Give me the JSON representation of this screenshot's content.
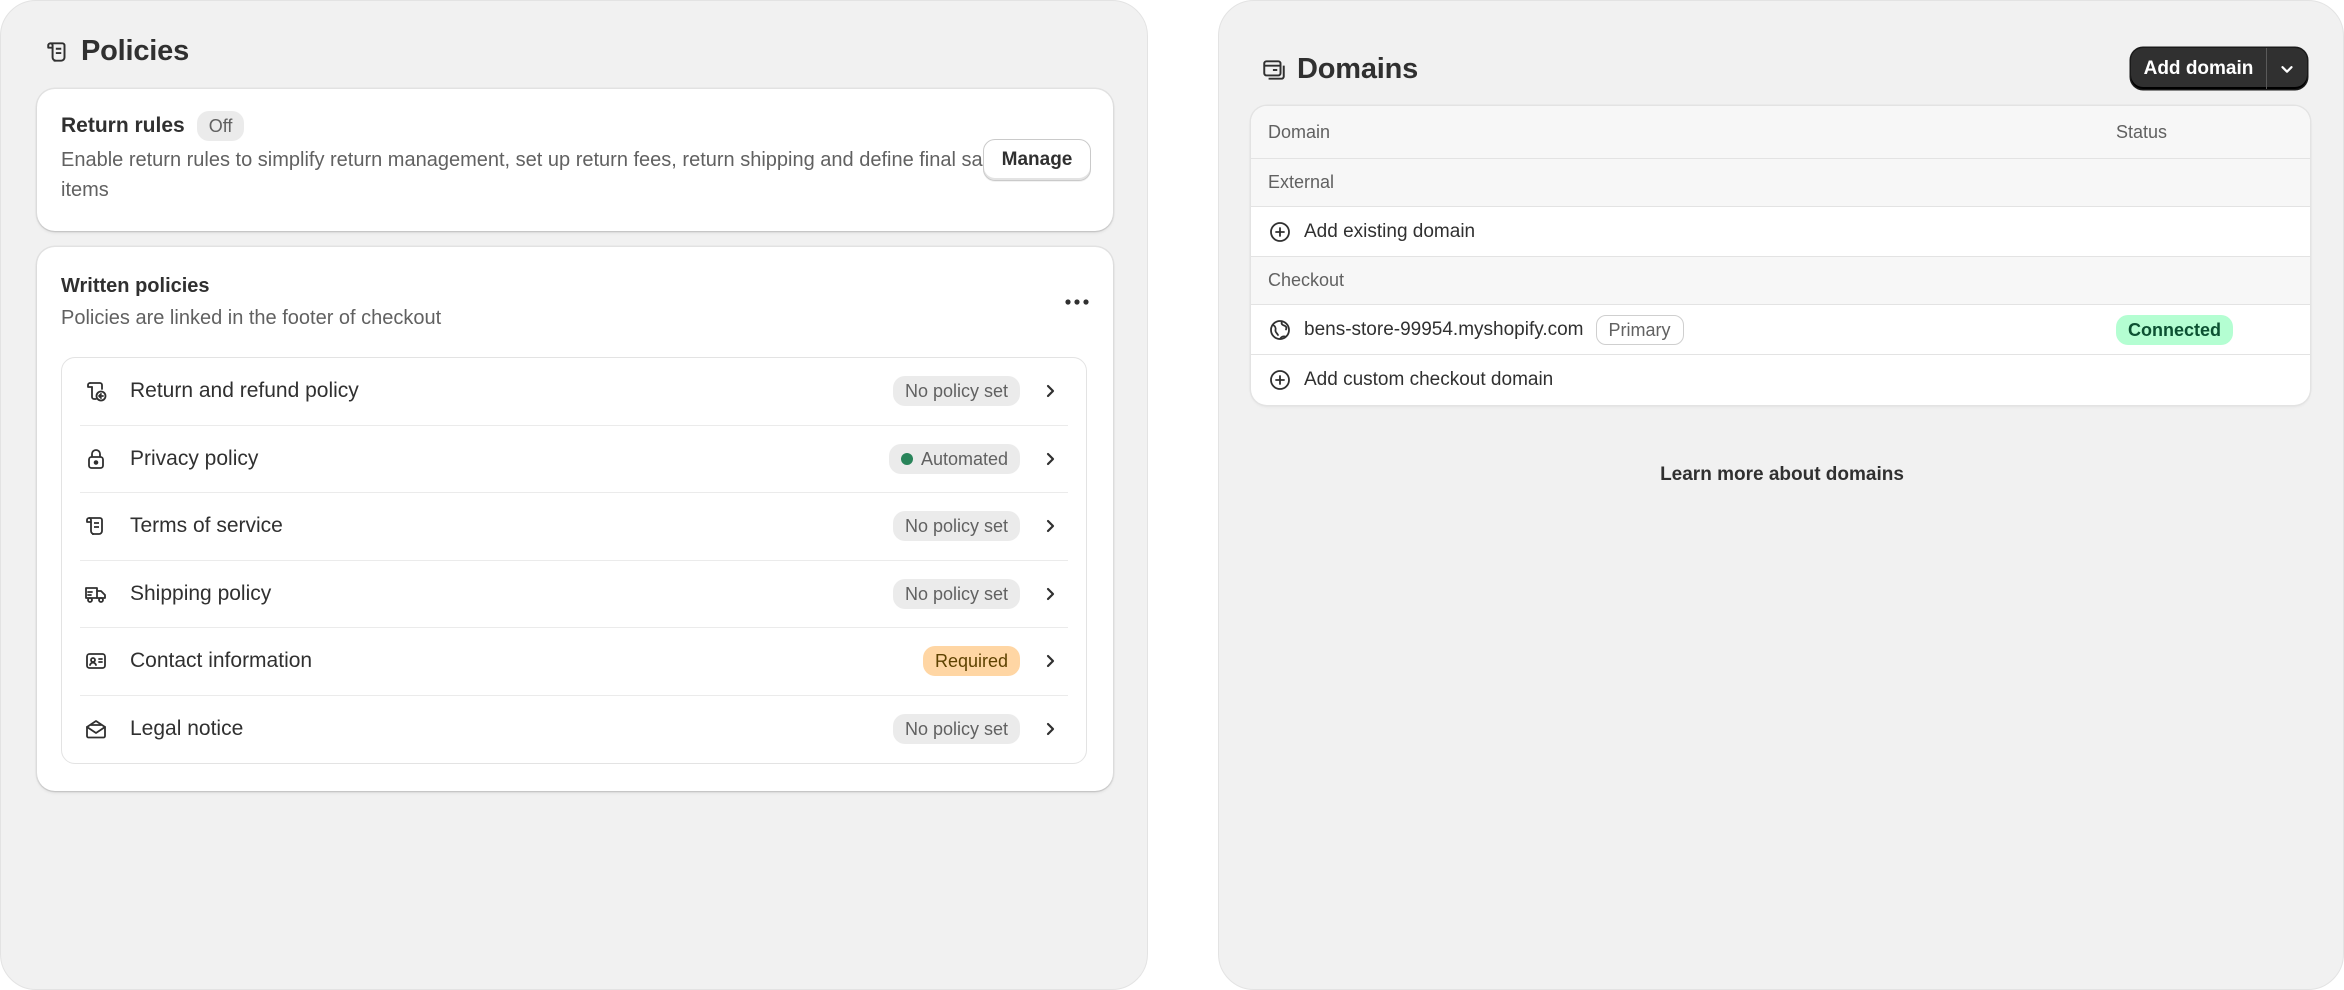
{
  "policies": {
    "title": "Policies",
    "return_rules": {
      "title": "Return rules",
      "status": "Off",
      "description": "Enable return rules to simplify return management, set up return fees, return shipping and define final sale items",
      "manage_label": "Manage"
    },
    "written": {
      "title": "Written policies",
      "subtitle": "Policies are linked in the footer of checkout",
      "items": [
        {
          "label": "Return and refund policy",
          "badge": "No policy set",
          "icon": "return-policy-icon"
        },
        {
          "label": "Privacy policy",
          "badge": "Automated",
          "icon": "lock-icon"
        },
        {
          "label": "Terms of service",
          "badge": "No policy set",
          "icon": "scroll-icon"
        },
        {
          "label": "Shipping policy",
          "badge": "No policy set",
          "icon": "truck-icon"
        },
        {
          "label": "Contact information",
          "badge": "Required",
          "icon": "id-card-icon"
        },
        {
          "label": "Legal notice",
          "badge": "No policy set",
          "icon": "envelope-icon"
        }
      ]
    }
  },
  "domains": {
    "title": "Domains",
    "add_domain_label": "Add domain",
    "table": {
      "col_domain": "Domain",
      "col_status": "Status",
      "group_external": "External",
      "add_existing": "Add existing domain",
      "group_checkout": "Checkout",
      "checkout_domain": "bens-store-99954.myshopify.com",
      "primary_tag": "Primary",
      "checkout_status": "Connected",
      "add_custom": "Add custom checkout domain"
    },
    "learn_more": "Learn more about domains"
  },
  "colors": {
    "panel_bg": "#f1f1f1",
    "connected_bg": "#b4fed2",
    "required_bg": "#ffd6a4",
    "automated_dot": "#29845a",
    "primary_button": "#303030"
  }
}
